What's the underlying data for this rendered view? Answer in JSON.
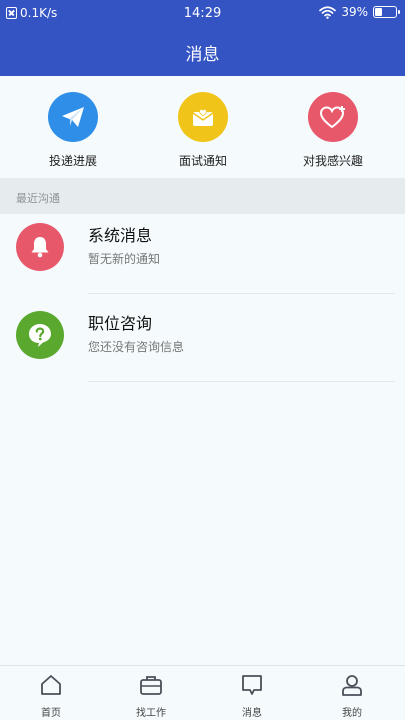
{
  "status_bar": {
    "network_speed": "0.1K/s",
    "time": "14:29",
    "battery_percent": "39%",
    "battery_level": 0.39
  },
  "header": {
    "title": "消息"
  },
  "quick_actions": [
    {
      "label": "投递进展",
      "icon": "paper-plane-icon",
      "color": "#2f8fe8"
    },
    {
      "label": "面试通知",
      "icon": "envelope-heart-icon",
      "color": "#f0c419"
    },
    {
      "label": "对我感兴趣",
      "icon": "heart-plus-icon",
      "color": "#e8586b"
    }
  ],
  "section": {
    "label": "最近沟通"
  },
  "messages": [
    {
      "title": "系统消息",
      "subtitle": "暂无新的通知",
      "icon": "bell-icon",
      "color": "#e8586b"
    },
    {
      "title": "职位咨询",
      "subtitle": "您还没有咨询信息",
      "icon": "question-bubble-icon",
      "color": "#5aa82d"
    }
  ],
  "bottom_nav": [
    {
      "label": "首页",
      "icon": "home-icon"
    },
    {
      "label": "找工作",
      "icon": "briefcase-icon"
    },
    {
      "label": "消息",
      "icon": "message-icon"
    },
    {
      "label": "我的",
      "icon": "user-icon"
    }
  ]
}
